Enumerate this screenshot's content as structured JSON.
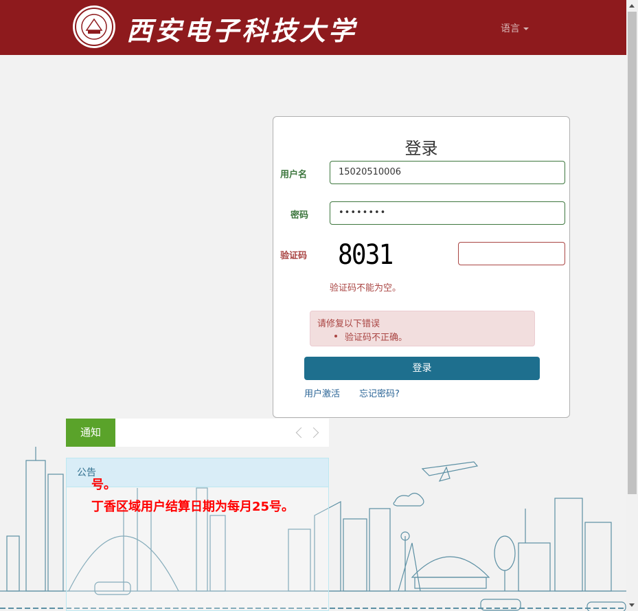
{
  "header": {
    "university_name": "西安电子科技大学",
    "language_label": "语言"
  },
  "login": {
    "title": "登录",
    "username_label": "用户名",
    "username_value": "15020510006",
    "password_label": "密码",
    "password_value": "••••••••",
    "captcha_label": "验证码",
    "captcha_image_text": "8031",
    "captcha_value": "",
    "captcha_help": "验证码不能为空。",
    "error_heading": "请修复以下错误",
    "error_item": "验证码不正确。",
    "submit_label": "登录",
    "activate_link": "用户激活",
    "forgot_link": "忘记密码?"
  },
  "notice": {
    "tab_label": "通知"
  },
  "announcement": {
    "heading": "公告",
    "partial_line": "号。",
    "text": "丁香区域用户结算日期为每月25号。"
  },
  "colors": {
    "header_bg": "#8e1a1d",
    "submit_bg": "#1e6f8e",
    "notice_tab_bg": "#5aa32a",
    "error_text": "#a94442",
    "success_text": "#3c763d",
    "announcement_text": "#ff0000"
  }
}
